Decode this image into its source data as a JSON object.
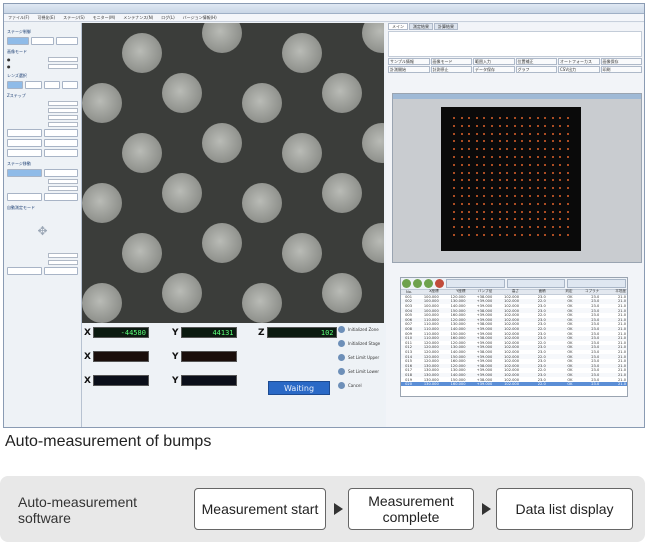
{
  "app": {
    "menu": [
      "ファイル(F)",
      "可視化(E)",
      "ステージ(S)",
      "モニター(M)",
      "メンテナンス(N)",
      "ログ(L)",
      "バージョン情報(H)"
    ]
  },
  "left_panel": {
    "sections": [
      "ステージ制御",
      "画像モード",
      "レンズ選択",
      "Zステップ",
      "ステージ移動",
      "自動測定モード"
    ]
  },
  "readouts": {
    "stage_x": "-44580",
    "stage_y": "44131",
    "stage_z": "102",
    "status": "Waiting"
  },
  "side_buttons": [
    "Initialized Zone",
    "Initialized Stage",
    "Set Limit Upper",
    "Set Limit Lower",
    "Cancel"
  ],
  "right_panel": {
    "tabs": [
      "メイン",
      "測定結果",
      "計算結果"
    ],
    "toolbar": [
      "サンプル情報",
      "画像モード",
      "範囲入力",
      "位置補正",
      "オートフォーカス",
      "画像保存",
      "計測開始",
      "計測停止",
      "データ保存",
      "グラフ",
      "CSV出力",
      "印刷"
    ],
    "table_headers": [
      "No.",
      "X座標",
      "Y座標",
      "バンプ径",
      "高さ",
      "面積",
      "判定",
      "コプラナ",
      "平坦度"
    ],
    "table_rows": [
      [
        "001",
        "100.000",
        "120.000",
        "+38.000",
        "102.000",
        "23.0",
        "OK",
        "23.0",
        "21.0"
      ],
      [
        "002",
        "100.000",
        "130.000",
        "+39.000",
        "102.000",
        "22.0",
        "OK",
        "23.0",
        "21.0"
      ],
      [
        "003",
        "100.000",
        "140.000",
        "+39.000",
        "102.000",
        "23.0",
        "OK",
        "23.0",
        "21.0"
      ],
      [
        "004",
        "100.000",
        "150.000",
        "+38.000",
        "102.000",
        "23.0",
        "OK",
        "23.0",
        "21.0"
      ],
      [
        "005",
        "100.000",
        "160.000",
        "+39.000",
        "102.000",
        "22.0",
        "OK",
        "23.0",
        "21.0"
      ],
      [
        "006",
        "110.000",
        "120.000",
        "+39.000",
        "102.000",
        "23.0",
        "OK",
        "23.0",
        "21.0"
      ],
      [
        "007",
        "110.000",
        "130.000",
        "+38.000",
        "102.000",
        "23.0",
        "OK",
        "23.0",
        "21.0"
      ],
      [
        "008",
        "110.000",
        "140.000",
        "+39.000",
        "102.000",
        "22.0",
        "OK",
        "23.0",
        "21.0"
      ],
      [
        "009",
        "110.000",
        "150.000",
        "+39.000",
        "102.000",
        "23.0",
        "OK",
        "23.0",
        "21.0"
      ],
      [
        "010",
        "110.000",
        "160.000",
        "+38.000",
        "102.000",
        "23.0",
        "OK",
        "23.0",
        "21.0"
      ],
      [
        "011",
        "120.000",
        "120.000",
        "+39.000",
        "102.000",
        "22.0",
        "OK",
        "23.0",
        "21.0"
      ],
      [
        "012",
        "120.000",
        "130.000",
        "+39.000",
        "102.000",
        "23.0",
        "OK",
        "23.0",
        "21.0"
      ],
      [
        "013",
        "120.000",
        "140.000",
        "+38.000",
        "102.000",
        "23.0",
        "OK",
        "23.0",
        "21.0"
      ],
      [
        "014",
        "120.000",
        "150.000",
        "+39.000",
        "102.000",
        "22.0",
        "OK",
        "23.0",
        "21.0"
      ],
      [
        "015",
        "120.000",
        "160.000",
        "+39.000",
        "102.000",
        "23.0",
        "OK",
        "23.0",
        "21.0"
      ],
      [
        "016",
        "130.000",
        "120.000",
        "+38.000",
        "102.000",
        "23.0",
        "OK",
        "23.0",
        "21.0"
      ],
      [
        "017",
        "130.000",
        "130.000",
        "+39.000",
        "102.000",
        "22.0",
        "OK",
        "23.0",
        "21.0"
      ],
      [
        "018",
        "130.000",
        "140.000",
        "+39.000",
        "102.000",
        "23.0",
        "OK",
        "23.0",
        "21.0"
      ],
      [
        "019",
        "130.000",
        "150.000",
        "+38.000",
        "102.000",
        "23.0",
        "OK",
        "23.0",
        "21.0"
      ],
      [
        "020",
        "130.000",
        "160.000",
        "+39.000",
        "102.000",
        "22.0",
        "OK",
        "23.0",
        "21.0"
      ]
    ]
  },
  "caption": "Auto-measurement of bumps",
  "flow": {
    "title": "Auto-measurement software",
    "steps": [
      "Measurement start",
      "Measurement complete",
      "Data list display"
    ]
  },
  "colors": {
    "bump": "#a5a7a2",
    "plot_dot": "#e0642c",
    "waiting_bg": "#2a69c6",
    "lcd_text": "#5cff7a"
  }
}
